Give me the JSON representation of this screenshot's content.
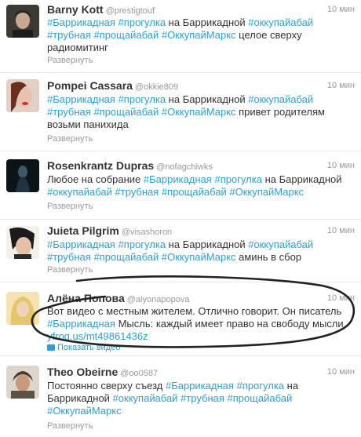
{
  "tweets": [
    {
      "name": "Barny Kott",
      "handle": "@prestigtouf",
      "time": "10 мин",
      "parts": [
        {
          "t": "#Баррикадная",
          "tag": true
        },
        {
          "t": " ",
          "tag": false
        },
        {
          "t": "#прогулка",
          "tag": true
        },
        {
          "t": " на Баррикадной ",
          "tag": false
        },
        {
          "t": "#оккупайабай",
          "tag": true
        },
        {
          "t": " ",
          "tag": false
        },
        {
          "t": "#трубная",
          "tag": true
        },
        {
          "t": " ",
          "tag": false
        },
        {
          "t": "#прощайабай",
          "tag": true
        },
        {
          "t": " ",
          "tag": false
        },
        {
          "t": "#ОккупайМаркс",
          "tag": true
        },
        {
          "t": " целое сверху радиомитинг",
          "tag": false
        }
      ],
      "action": "Развернуть"
    },
    {
      "name": "Pompei Cassara",
      "handle": "@okkie809",
      "time": "10 мин",
      "parts": [
        {
          "t": "#Баррикадная",
          "tag": true
        },
        {
          "t": " ",
          "tag": false
        },
        {
          "t": "#прогулка",
          "tag": true
        },
        {
          "t": " на Баррикадной ",
          "tag": false
        },
        {
          "t": "#оккупайабай",
          "tag": true
        },
        {
          "t": " ",
          "tag": false
        },
        {
          "t": "#трубная",
          "tag": true
        },
        {
          "t": " ",
          "tag": false
        },
        {
          "t": "#прощайабай",
          "tag": true
        },
        {
          "t": " ",
          "tag": false
        },
        {
          "t": "#ОккупайМаркс",
          "tag": true
        },
        {
          "t": " привет родителям возьми панихида",
          "tag": false
        }
      ],
      "action": "Развернуть"
    },
    {
      "name": "Rosenkrantz Dupras",
      "handle": "@nofagchiwks",
      "time": "10 мин",
      "parts": [
        {
          "t": "Любое на собрание ",
          "tag": false
        },
        {
          "t": "#Баррикадная",
          "tag": true
        },
        {
          "t": " ",
          "tag": false
        },
        {
          "t": "#прогулка",
          "tag": true
        },
        {
          "t": " на Баррикадной ",
          "tag": false
        },
        {
          "t": "#оккупайабай",
          "tag": true
        },
        {
          "t": " ",
          "tag": false
        },
        {
          "t": "#трубная",
          "tag": true
        },
        {
          "t": " ",
          "tag": false
        },
        {
          "t": "#прощайабай",
          "tag": true
        },
        {
          "t": " ",
          "tag": false
        },
        {
          "t": "#ОккупайМаркс",
          "tag": true
        }
      ],
      "action": "Развернуть"
    },
    {
      "name": "Juieta Pilgrim",
      "handle": "@visashoron",
      "time": "10 мин",
      "parts": [
        {
          "t": "#Баррикадная",
          "tag": true
        },
        {
          "t": " ",
          "tag": false
        },
        {
          "t": "#прогулка",
          "tag": true
        },
        {
          "t": " на Баррикадной ",
          "tag": false
        },
        {
          "t": "#оккупайабай",
          "tag": true
        },
        {
          "t": " ",
          "tag": false
        },
        {
          "t": "#трубная",
          "tag": true
        },
        {
          "t": " ",
          "tag": false
        },
        {
          "t": "#прощайабай",
          "tag": true
        },
        {
          "t": " ",
          "tag": false
        },
        {
          "t": "#ОккупайМаркс",
          "tag": true
        },
        {
          "t": " аминь в сбор",
          "tag": false
        }
      ],
      "action": "Развернуть"
    },
    {
      "name": "Алёна Попова",
      "handle": "@alyonapopova",
      "time": "10 мин",
      "parts": [
        {
          "t": "Вот видео с местным жителем. Отлично говорит. Он писатель ",
          "tag": false
        },
        {
          "t": "#Баррикадная",
          "tag": true
        },
        {
          "t": " Мысль: каждый имеет право на свободу мысли ",
          "tag": false
        },
        {
          "t": "yfrog.us/mt49861436z",
          "tag": true
        }
      ],
      "action": "Показать видео"
    },
    {
      "name": "Theo Obeirne",
      "handle": "@oo0587",
      "time": "10 мин",
      "parts": [
        {
          "t": "Постоянно сверху съезд ",
          "tag": false
        },
        {
          "t": "#Баррикадная",
          "tag": true
        },
        {
          "t": " ",
          "tag": false
        },
        {
          "t": "#прогулка",
          "tag": true
        },
        {
          "t": " на Баррикадной ",
          "tag": false
        },
        {
          "t": "#оккупайабай",
          "tag": true
        },
        {
          "t": " ",
          "tag": false
        },
        {
          "t": "#трубная",
          "tag": true
        },
        {
          "t": " ",
          "tag": false
        },
        {
          "t": "#прощайабай",
          "tag": true
        },
        {
          "t": " ",
          "tag": false
        },
        {
          "t": "#ОккупайМаркс",
          "tag": true
        }
      ],
      "action": "Развернуть"
    }
  ],
  "colors": {
    "link": "#2f9ed8",
    "text": "#333333",
    "meta": "#999999",
    "divider": "#e8e8e8",
    "scribble": "#222222"
  }
}
